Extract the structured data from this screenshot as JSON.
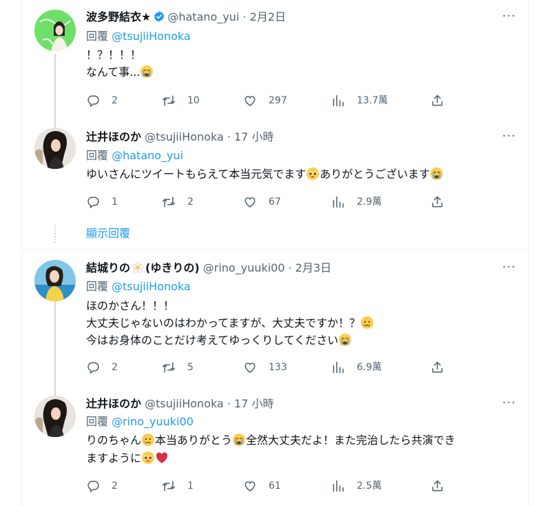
{
  "tweets": [
    {
      "name": "波多野結衣★",
      "verified": true,
      "handle": "@hatano_yui",
      "dot": " · ",
      "time": "2月2日",
      "reply_prefix": "回覆 ",
      "reply_mention": "@tsujiiHonoka",
      "lines": [
        "！？！！！",
        "なんて事..."
      ],
      "replies": "2",
      "retweets": "10",
      "likes": "297",
      "views": "13.7萬"
    },
    {
      "name": "辻井ほのか",
      "handle": "@tsujiiHonoka",
      "dot": " · ",
      "time": "17 小時",
      "reply_prefix": "回覆 ",
      "reply_mention": "@hatano_yui",
      "line_a": "ゆいさんにツイートもらえて本当元気でます",
      "line_b": "ありがとうございます",
      "replies": "1",
      "retweets": "2",
      "likes": "67",
      "views": "2.9萬"
    },
    {
      "name_a": "結城りの",
      "name_b": "(ゆきりの)",
      "handle": "@rino_yuuki00",
      "dot": " · ",
      "time": "2月3日",
      "reply_prefix": "回覆 ",
      "reply_mention": "@tsujiiHonoka",
      "line1": "ほのかさん！！！",
      "line2": "大丈夫じゃないのはわかってますが、大丈夫ですか！？",
      "line3": "今はお身体のことだけ考えてゆっくりしてください",
      "replies": "2",
      "retweets": "5",
      "likes": "133",
      "views": "6.9萬"
    },
    {
      "name": "辻井ほのか",
      "handle": "@tsujiiHonoka",
      "dot": " · ",
      "time": "17 小時",
      "reply_prefix": "回覆 ",
      "reply_mention": "@rino_yuuki00",
      "l1a": "りのちゃん",
      "l1b": "本当ありがとう",
      "l1c": "全然大丈夫だよ！また完治したら共演でき",
      "l2": "ますように",
      "replies": "2",
      "retweets": "1",
      "likes": "61",
      "views": "2.5萬"
    }
  ],
  "show_replies": "顯示回覆",
  "more_label": "···",
  "icons": {
    "reply": "reply-icon",
    "retweet": "retweet-icon",
    "like": "like-icon",
    "views": "views-icon",
    "share": "share-icon",
    "more": "more-icon",
    "verified": "verified-badge-icon"
  },
  "colors": {
    "accent": "#1d9bf0",
    "muted": "#536471",
    "text": "#0f1419",
    "line": "#cfd9de"
  }
}
